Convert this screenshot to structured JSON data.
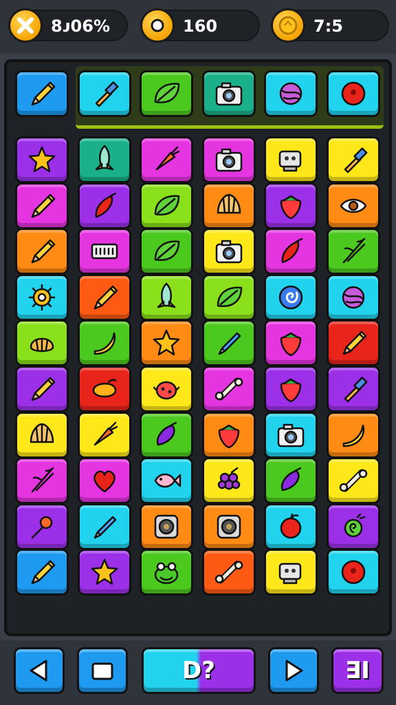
{
  "hud": {
    "stat1": {
      "icon": "close-x-coin-icon",
      "value": "8ᴊ06%"
    },
    "stat2": {
      "icon": "coin-icon",
      "value": "160"
    },
    "stat3": {
      "icon": "timer-coin-icon",
      "value": "7:5"
    }
  },
  "colors": {
    "blue": "#1e9bf0",
    "cyan": "#22d3ee",
    "green": "#4cc91f",
    "teal": "#1ab08a",
    "purple": "#9b30e8",
    "magenta": "#e535e0",
    "yellow": "#ffe81a",
    "orange": "#ff8a14",
    "red": "#e8241b",
    "lime": "#8ae01a",
    "orangeRed": "#ff5a14"
  },
  "top_row": [
    {
      "color": "blue",
      "icon": "pencil-icon"
    },
    {
      "color": "cyan",
      "icon": "brush-icon"
    },
    {
      "color": "green",
      "icon": "leaf-icon"
    },
    {
      "color": "teal",
      "icon": "camera-icon"
    },
    {
      "color": "cyan",
      "icon": "yarn-icon"
    },
    {
      "color": "cyan",
      "icon": "ball-icon"
    }
  ],
  "grid": [
    [
      {
        "color": "purple",
        "icon": "star-icon"
      },
      {
        "color": "teal",
        "icon": "rocket-icon"
      },
      {
        "color": "magenta",
        "icon": "carrot-icon"
      },
      {
        "color": "magenta",
        "icon": "camera-icon"
      },
      {
        "color": "yellow",
        "icon": "robot-icon"
      },
      {
        "color": "yellow",
        "icon": "brush-icon"
      }
    ],
    [
      {
        "color": "magenta",
        "icon": "pencil-icon"
      },
      {
        "color": "purple",
        "icon": "chili-icon"
      },
      {
        "color": "lime",
        "icon": "leaf-icon"
      },
      {
        "color": "orange",
        "icon": "shell-icon"
      },
      {
        "color": "purple",
        "icon": "strawberry-icon"
      },
      {
        "color": "orange",
        "icon": "eye-icon"
      }
    ],
    [
      {
        "color": "orange",
        "icon": "pencil-icon"
      },
      {
        "color": "magenta",
        "icon": "keyboard-icon"
      },
      {
        "color": "green",
        "icon": "leaf-icon"
      },
      {
        "color": "yellow",
        "icon": "camera-icon"
      },
      {
        "color": "magenta",
        "icon": "chili-icon"
      },
      {
        "color": "green",
        "icon": "bamboo-icon"
      }
    ],
    [
      {
        "color": "cyan",
        "icon": "gear-icon"
      },
      {
        "color": "orangeRed",
        "icon": "pencil-icon"
      },
      {
        "color": "lime",
        "icon": "rocket-icon"
      },
      {
        "color": "lime",
        "icon": "leaf-icon"
      },
      {
        "color": "cyan",
        "icon": "spiral-icon"
      },
      {
        "color": "cyan",
        "icon": "yarn-icon"
      }
    ],
    [
      {
        "color": "lime",
        "icon": "bread-icon"
      },
      {
        "color": "green",
        "icon": "banana-icon"
      },
      {
        "color": "orange",
        "icon": "star-icon"
      },
      {
        "color": "green",
        "icon": "crayon-icon"
      },
      {
        "color": "magenta",
        "icon": "strawberry-icon"
      },
      {
        "color": "red",
        "icon": "pencil-icon"
      }
    ],
    [
      {
        "color": "purple",
        "icon": "pencil-icon"
      },
      {
        "color": "red",
        "icon": "mango-icon"
      },
      {
        "color": "yellow",
        "icon": "bug-icon"
      },
      {
        "color": "magenta",
        "icon": "bone-icon"
      },
      {
        "color": "purple",
        "icon": "strawberry-icon"
      },
      {
        "color": "purple",
        "icon": "brush-icon"
      }
    ],
    [
      {
        "color": "yellow",
        "icon": "shell-icon"
      },
      {
        "color": "yellow",
        "icon": "carrot-icon"
      },
      {
        "color": "green",
        "icon": "eggplant-icon"
      },
      {
        "color": "orange",
        "icon": "strawberry-icon"
      },
      {
        "color": "cyan",
        "icon": "camera-icon"
      },
      {
        "color": "orange",
        "icon": "banana-icon"
      }
    ],
    [
      {
        "color": "magenta",
        "icon": "bamboo-icon"
      },
      {
        "color": "magenta",
        "icon": "heart-icon"
      },
      {
        "color": "cyan",
        "icon": "fish-icon"
      },
      {
        "color": "yellow",
        "icon": "grapes-icon"
      },
      {
        "color": "green",
        "icon": "eggplant-icon"
      },
      {
        "color": "yellow",
        "icon": "bone-icon"
      }
    ],
    [
      {
        "color": "purple",
        "icon": "pin-icon"
      },
      {
        "color": "cyan",
        "icon": "crayon-icon"
      },
      {
        "color": "orange",
        "icon": "speaker-icon"
      },
      {
        "color": "orange",
        "icon": "speaker-icon"
      },
      {
        "color": "cyan",
        "icon": "apple-icon"
      },
      {
        "color": "purple",
        "icon": "snail-icon"
      }
    ],
    [
      {
        "color": "blue",
        "icon": "pencil-icon"
      },
      {
        "color": "purple",
        "icon": "star-icon"
      },
      {
        "color": "green",
        "icon": "frog-icon"
      },
      {
        "color": "orangeRed",
        "icon": "bone-icon"
      },
      {
        "color": "yellow",
        "icon": "robot-icon"
      },
      {
        "color": "cyan",
        "icon": "ball-icon"
      }
    ]
  ],
  "controls": {
    "prev": {
      "icon": "triangle-left-icon"
    },
    "stop": {
      "icon": "square-icon"
    },
    "hint": {
      "label": "D?"
    },
    "next": {
      "icon": "triangle-right-icon"
    },
    "menu": {
      "label": "∃I"
    }
  }
}
